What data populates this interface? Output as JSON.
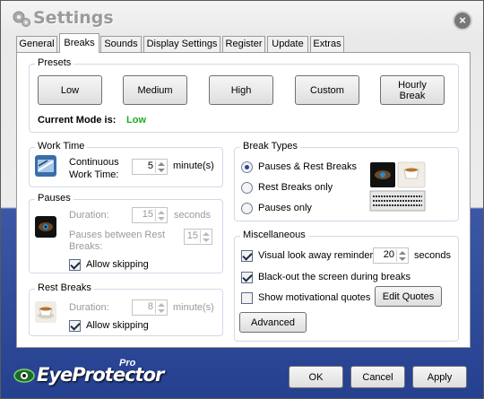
{
  "window": {
    "title": "Settings",
    "close_label": "×"
  },
  "tabs": [
    {
      "label": "General"
    },
    {
      "label": "Breaks"
    },
    {
      "label": "Sounds"
    },
    {
      "label": "Display Settings"
    },
    {
      "label": "Register"
    },
    {
      "label": "Update"
    },
    {
      "label": "Extras"
    }
  ],
  "active_tab": "Breaks",
  "presets": {
    "title": "Presets",
    "buttons": [
      "Low",
      "Medium",
      "High",
      "Custom",
      "Hourly Break"
    ],
    "current_mode_label": "Current Mode is:",
    "current_mode_value": "Low",
    "current_mode_color": "#1bb01b"
  },
  "work_time": {
    "title": "Work Time",
    "label": "Continuous Work Time:",
    "value": "5",
    "unit": "minute(s)",
    "icon": "keyboard-icon"
  },
  "pauses": {
    "title": "Pauses",
    "duration_label": "Duration:",
    "duration_value": "15",
    "duration_unit": "seconds",
    "between_label": "Pauses between Rest Breaks:",
    "between_value": "15",
    "allow_skipping_label": "Allow skipping",
    "allow_skipping": true,
    "icon": "eye-icon"
  },
  "rest_breaks": {
    "title": "Rest Breaks",
    "duration_label": "Duration:",
    "duration_value": "8",
    "duration_unit": "minute(s)",
    "allow_skipping_label": "Allow skipping",
    "allow_skipping": true,
    "icon": "coffee-cup-icon"
  },
  "break_types": {
    "title": "Break Types",
    "options": [
      "Pauses & Rest Breaks",
      "Rest Breaks only",
      "Pauses only"
    ],
    "selected": "Pauses & Rest Breaks"
  },
  "misc": {
    "title": "Miscellaneous",
    "look_away_label": "Visual look away reminder:",
    "look_away_checked": true,
    "look_away_value": "20",
    "look_away_unit": "seconds",
    "blackout_label": "Black-out the screen during breaks",
    "blackout_checked": true,
    "motivational_label": "Show motivational quotes",
    "motivational_checked": false,
    "edit_quotes_label": "Edit Quotes",
    "advanced_label": "Advanced"
  },
  "footer": {
    "logo_text": "EyeProtector",
    "logo_pro": "Pro",
    "ok_label": "OK",
    "cancel_label": "Cancel",
    "apply_label": "Apply"
  },
  "colors": {
    "accent_blue": "#2a469a",
    "mode_green": "#1bb01b"
  }
}
